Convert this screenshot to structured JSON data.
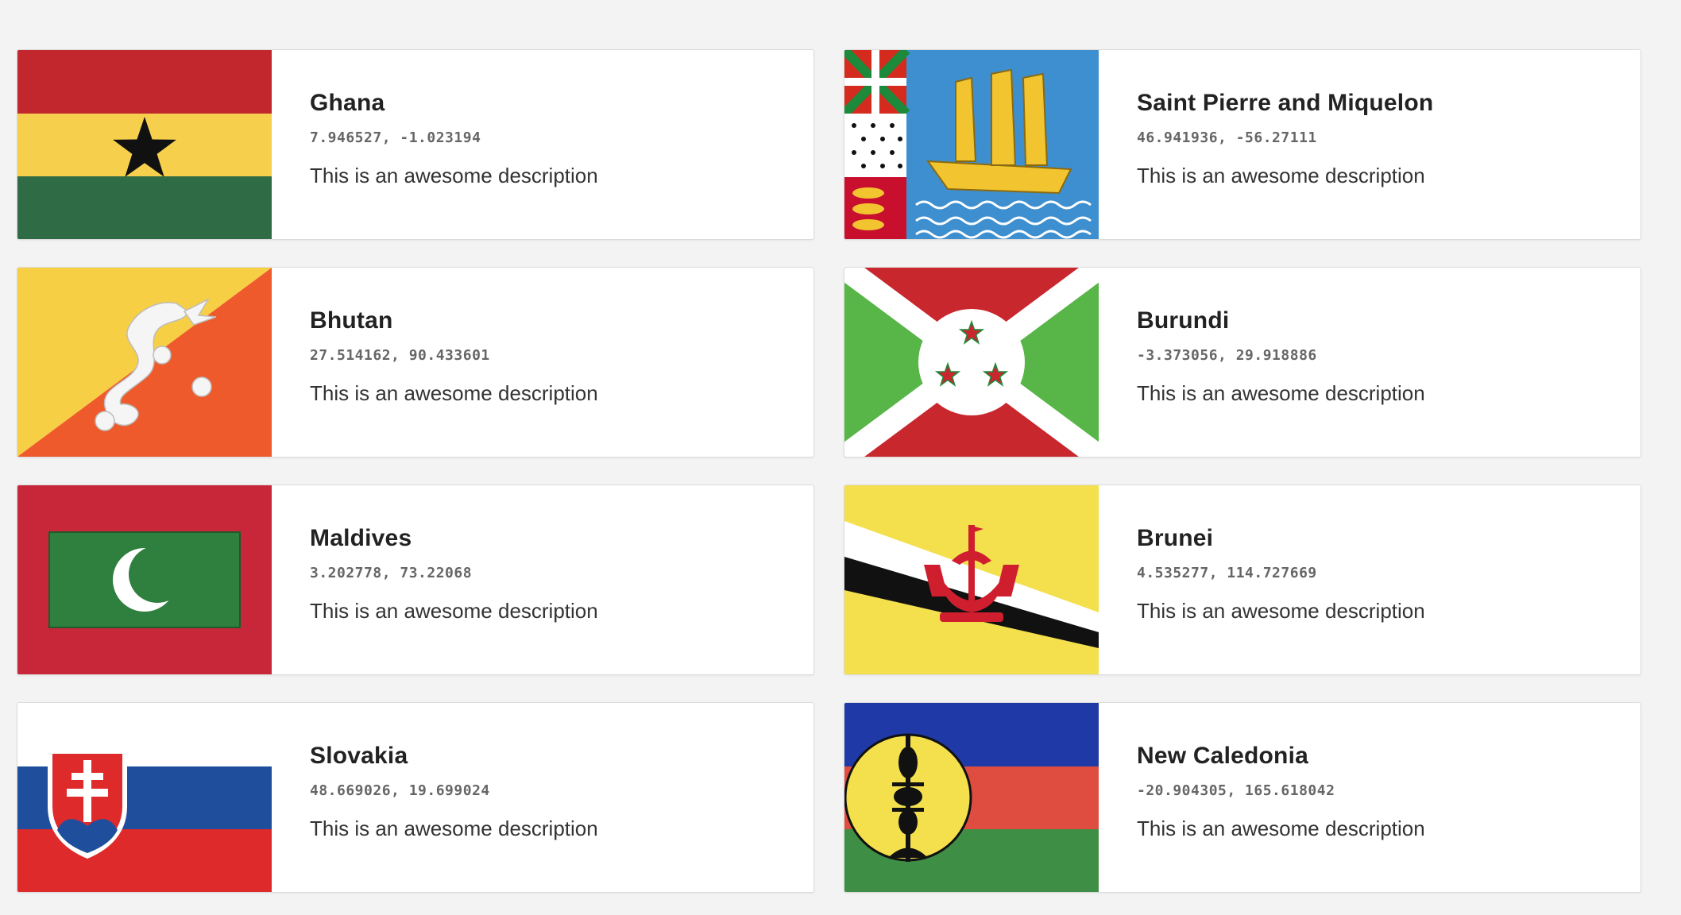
{
  "places": [
    {
      "name": "Ghana",
      "coords": "7.946527, -1.023194",
      "description": "This is an awesome description",
      "flag": "ghana-flag"
    },
    {
      "name": "Saint Pierre and Miquelon",
      "coords": "46.941936, -56.27111",
      "description": "This is an awesome description",
      "flag": "saint-pierre-and-miquelon-flag"
    },
    {
      "name": "Bhutan",
      "coords": "27.514162, 90.433601",
      "description": "This is an awesome description",
      "flag": "bhutan-flag"
    },
    {
      "name": "Burundi",
      "coords": "-3.373056, 29.918886",
      "description": "This is an awesome description",
      "flag": "burundi-flag"
    },
    {
      "name": "Maldives",
      "coords": "3.202778, 73.22068",
      "description": "This is an awesome description",
      "flag": "maldives-flag"
    },
    {
      "name": "Brunei",
      "coords": "4.535277, 114.727669",
      "description": "This is an awesome description",
      "flag": "brunei-flag"
    },
    {
      "name": "Slovakia",
      "coords": "48.669026, 19.699024",
      "description": "This is an awesome description",
      "flag": "slovakia-flag"
    },
    {
      "name": "New Caledonia",
      "coords": "-20.904305, 165.618042",
      "description": "This is an awesome description",
      "flag": "new-caledonia-flag"
    }
  ]
}
